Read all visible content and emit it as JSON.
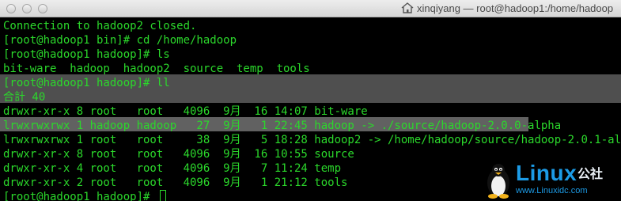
{
  "window": {
    "title": "xinqiyang — root@hadoop1:/home/hadoop"
  },
  "terminal": {
    "lines": [
      "Connection to hadoop2 closed.",
      "[root@hadoop1 bin]# cd /home/hadoop",
      "[root@hadoop1 hadoop]# ls",
      "bit-ware  hadoop  hadoop2  source  temp  tools",
      "[root@hadoop1 hadoop]# ll",
      "合計 40",
      "drwxr-xr-x 8 root   root   4096  9月  16 14:07 bit-ware",
      "lrwxrwxrwx 1 hadoop hadoop   27  9月   1 22:45 hadoop -> ./source/hadoop-2.0.0-alpha",
      "lrwxrwxrwx 1 root   root     38  9月   5 18:28 hadoop2 -> /home/hadoop/source/hadoop-2.0.1-alpha",
      "drwxr-xr-x 8 root   root   4096  9月  16 10:55 source",
      "drwxr-xr-x 4 root   root   4096  9月   7 11:24 temp",
      "drwxr-xr-x 2 root   root   4096  9月   1 21:12 tools",
      "[root@hadoop1 hadoop]# "
    ]
  },
  "watermark": {
    "brand": "Linux",
    "brand_cn": "公社",
    "url": "www.Linuxidc.com"
  },
  "colors": {
    "terminal_text": "#2bd82b",
    "selection": "#6a6a6a",
    "brand": "#1c9be6"
  }
}
